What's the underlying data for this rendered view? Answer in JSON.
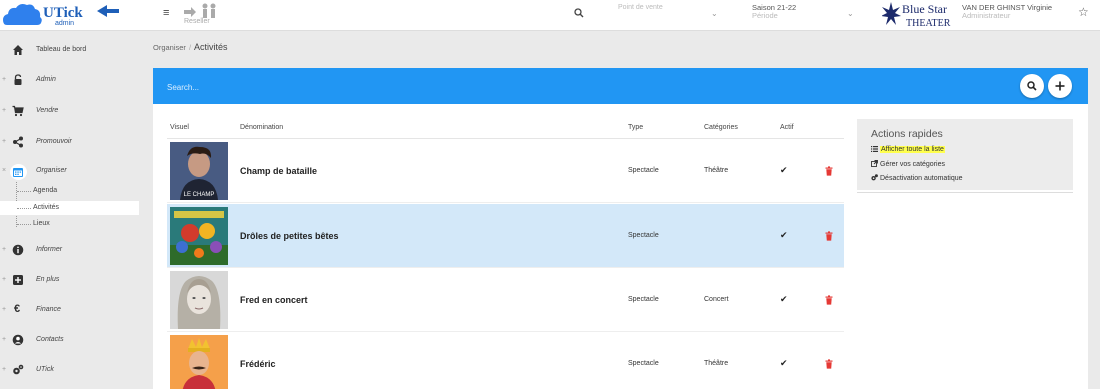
{
  "brand": {
    "name": "UTick",
    "sub": "admin",
    "reseller_label": "Reseller"
  },
  "header": {
    "point_de_vente_placeholder": "Point de vente",
    "saison": "Saison 21-22",
    "saison_sub": "Période",
    "venue_logo_text": [
      "Blue Star",
      "THEATER"
    ],
    "user_name": "VAN DER GHINST Virginie",
    "user_role": "Administrateur"
  },
  "sidebar": {
    "items": [
      {
        "label": "Tableau de bord",
        "icon": "home-icon"
      },
      {
        "label": "Admin",
        "icon": "lock-icon"
      },
      {
        "label": "Vendre",
        "icon": "cart-icon"
      },
      {
        "label": "Promouvoir",
        "icon": "share-icon"
      },
      {
        "label": "Organiser",
        "icon": "calendar-icon"
      },
      {
        "label": "Informer",
        "icon": "info-icon"
      },
      {
        "label": "En plus",
        "icon": "plus-square-icon"
      },
      {
        "label": "Finance",
        "icon": "euro-icon"
      },
      {
        "label": "Contacts",
        "icon": "user-circle-icon"
      },
      {
        "label": "UTick",
        "icon": "cogs-icon"
      }
    ],
    "expanded_marker": "×",
    "collapsed_marker": "+",
    "sub_items": [
      "Agenda",
      "Activités",
      "Lieux"
    ]
  },
  "breadcrumb": {
    "parent": "Organiser",
    "separator": "/",
    "current": "Activités"
  },
  "search": {
    "placeholder": "Search..."
  },
  "table": {
    "headers": [
      "Visuel",
      "Dénomination",
      "Type",
      "Catégories",
      "Actif"
    ],
    "rows": [
      {
        "name": "Champ de bataille",
        "type": "Spectacle",
        "category": "Théâtre",
        "active": "✔",
        "poster_text": "LE CHAMP"
      },
      {
        "name": "Drôles de petites bêtes",
        "type": "Spectacle",
        "category": "",
        "active": "✔"
      },
      {
        "name": "Fred en concert",
        "type": "Spectacle",
        "category": "Concert",
        "active": "✔"
      },
      {
        "name": "Frédéric",
        "type": "Spectacle",
        "category": "Théâtre",
        "active": "✔"
      }
    ]
  },
  "quick_actions": {
    "title": "Actions rapides",
    "links": [
      "Afficher toute la liste",
      "Gérer vos catégories",
      "Désactivation automatique"
    ]
  },
  "colors": {
    "accent": "#2196f3",
    "selected_row": "#d3e8f9",
    "highlight": "#ffff4d",
    "danger": "#e53935"
  }
}
